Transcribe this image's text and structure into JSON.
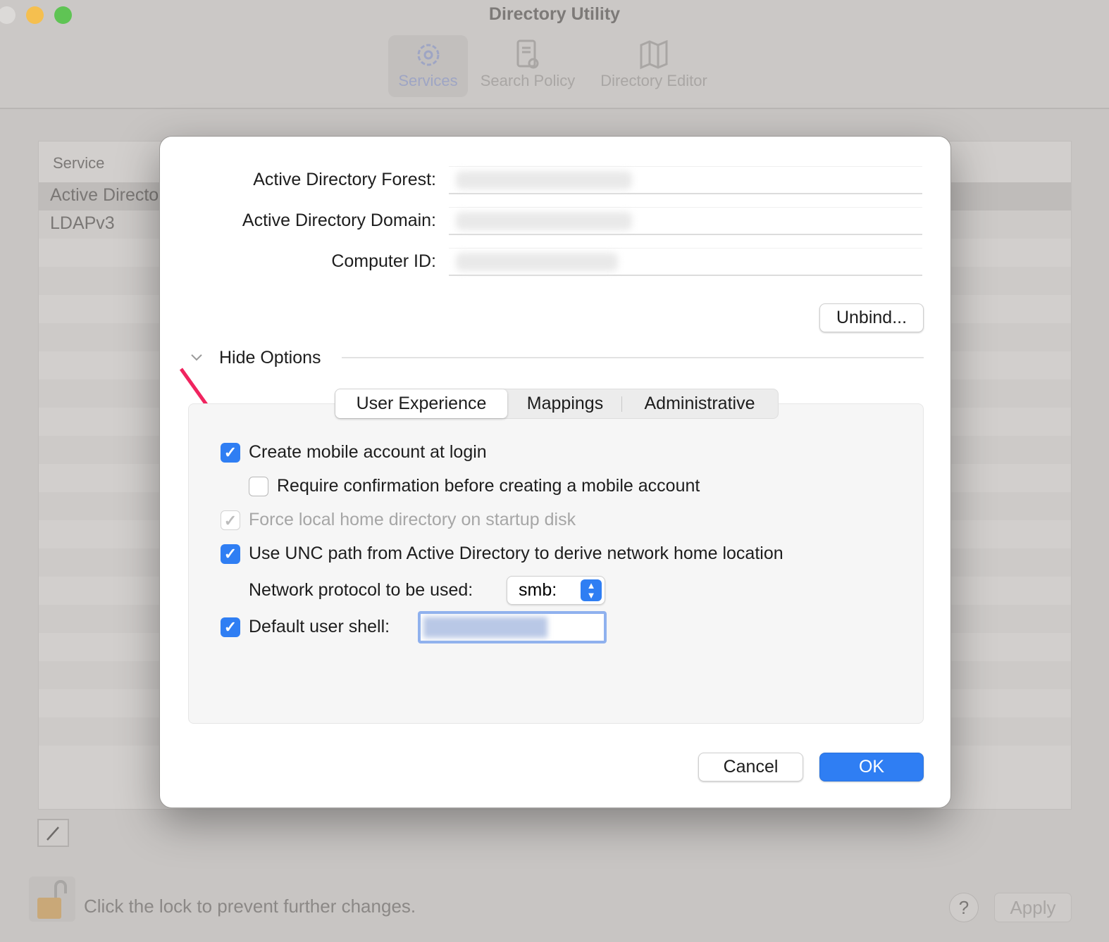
{
  "window": {
    "title": "Directory Utility"
  },
  "toolbar": {
    "items": [
      {
        "label": "Services",
        "icon": "gear-icon",
        "selected": true
      },
      {
        "label": "Search Policy",
        "icon": "document-search-icon"
      },
      {
        "label": "Directory Editor",
        "icon": "map-icon"
      }
    ]
  },
  "service_list": {
    "header": "Service",
    "rows": [
      "Active Directory",
      "LDAPv3"
    ]
  },
  "footer": {
    "lock_text": "Click the lock to prevent further changes.",
    "help_label": "?",
    "apply_label": "Apply"
  },
  "dialog": {
    "fields": [
      {
        "label": "Active Directory Forest:",
        "value": ""
      },
      {
        "label": "Active Directory Domain:",
        "value": ""
      },
      {
        "label": "Computer ID:",
        "value": ""
      }
    ],
    "unbind_label": "Unbind...",
    "options_toggle": "Hide Options",
    "tabs": [
      {
        "label": "User Experience",
        "selected": true
      },
      {
        "label": "Mappings"
      },
      {
        "label": "Administrative"
      }
    ],
    "options": [
      {
        "label": "Create mobile account at login",
        "checked": true
      },
      {
        "label": "Require confirmation before creating a mobile account",
        "checked": false
      },
      {
        "label": "Force local home directory on startup disk",
        "checked": true,
        "disabled": true
      },
      {
        "label": "Use UNC path from Active Directory to derive network home location",
        "checked": true
      }
    ],
    "protocol": {
      "label": "Network protocol to be used:",
      "value": "smb:"
    },
    "shell": {
      "label": "Default user shell:",
      "checked": true,
      "value": ""
    },
    "cancel_label": "Cancel",
    "ok_label": "OK"
  },
  "colors": {
    "accent": "#2f7ef3",
    "annotation_arrow": "#f0245f"
  }
}
